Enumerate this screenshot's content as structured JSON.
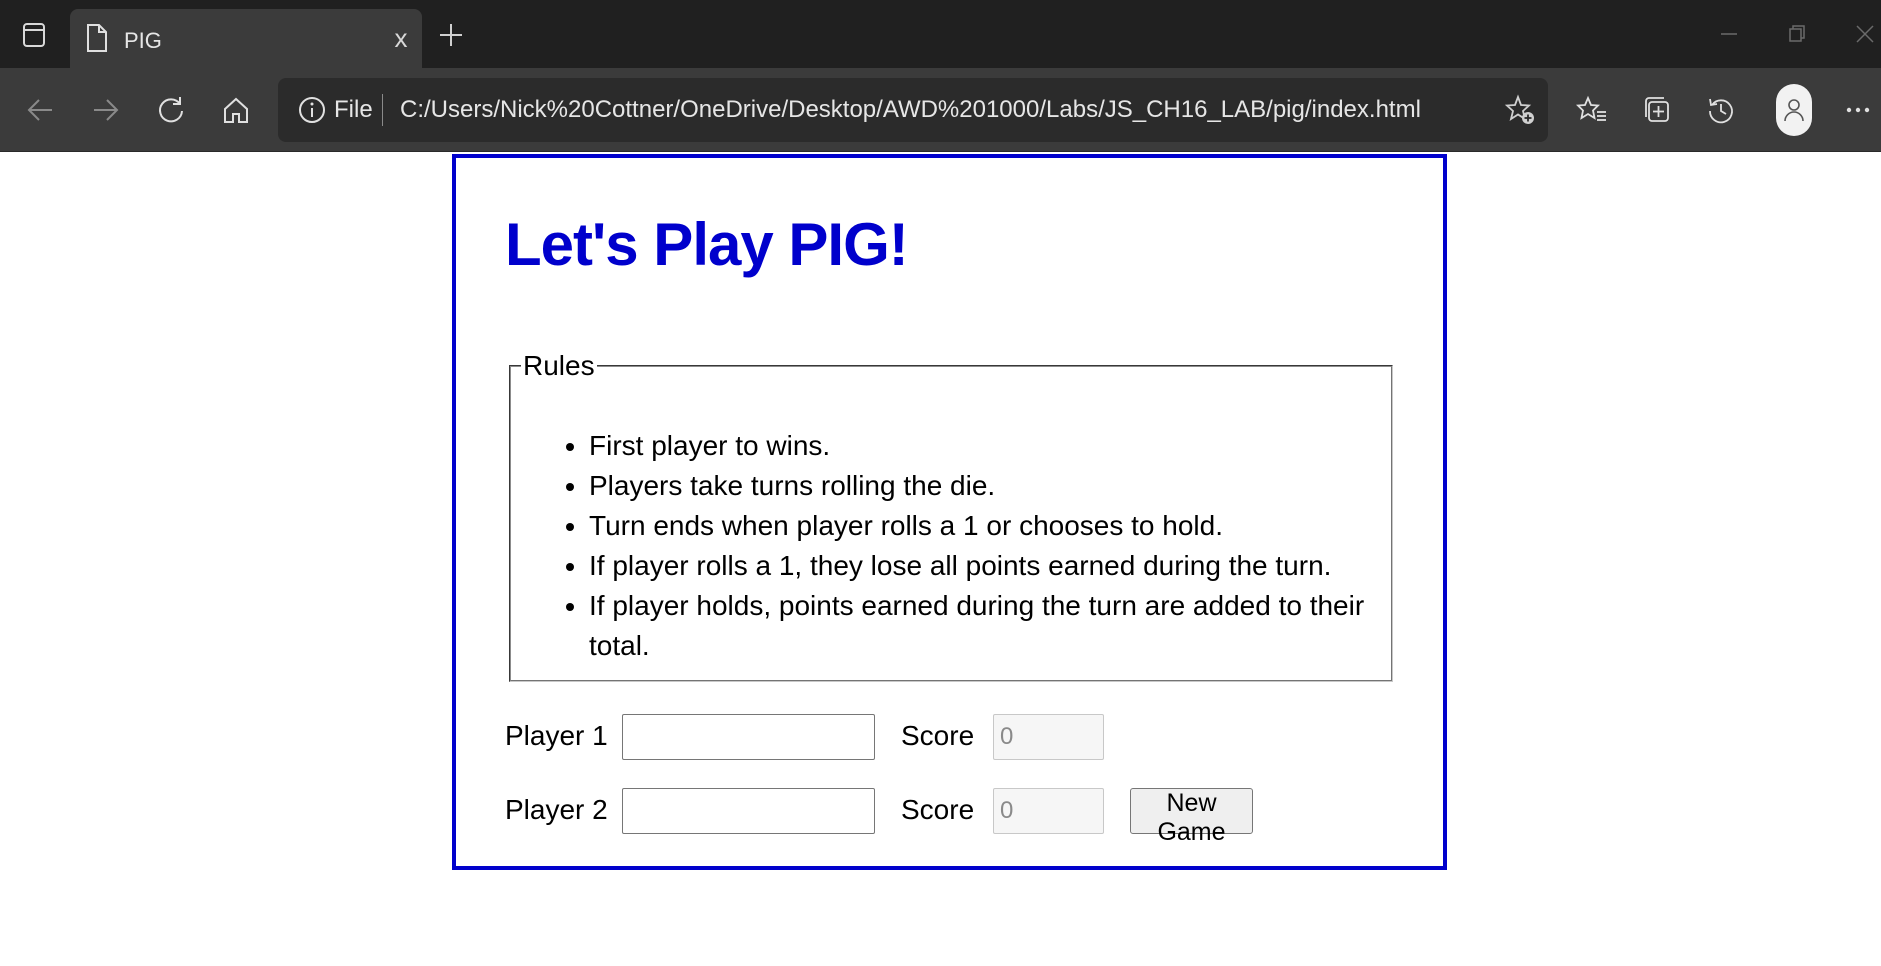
{
  "browser": {
    "tab_title": "PIG",
    "tab_close_label": "x",
    "address_scheme": "File",
    "address_url": "C:/Users/Nick%20Cottner/OneDrive/Desktop/AWD%201000/Labs/JS_CH16_LAB/pig/index.html",
    "icons": {
      "tab_actions": "tab-actions-icon",
      "page": "page-icon",
      "new_tab": "plus-icon",
      "minimize": "minimize-icon",
      "restore": "restore-icon",
      "close": "close-icon",
      "back": "back-arrow-icon",
      "forward": "forward-arrow-icon",
      "refresh": "refresh-icon",
      "home": "home-icon",
      "info": "info-icon",
      "add_favorite": "star-plus-icon",
      "favorites": "favorites-icon",
      "collections": "collections-icon",
      "history": "history-icon",
      "profile": "profile-icon",
      "menu": "more-icon"
    }
  },
  "page": {
    "title": "Let's Play PIG!",
    "rules": {
      "legend": "Rules",
      "items": [
        "First player to wins.",
        "Players take turns rolling the die.",
        "Turn ends when player rolls a 1 or chooses to hold.",
        "If player rolls a 1, they lose all points earned during the turn.",
        "If player holds, points earned during the turn are added to their total."
      ]
    },
    "players": [
      {
        "label": "Player 1",
        "name_value": "",
        "score_label": "Score",
        "score_value": "0"
      },
      {
        "label": "Player 2",
        "name_value": "",
        "score_label": "Score",
        "score_value": "0"
      }
    ],
    "new_game_label": "New Game"
  },
  "colors": {
    "accent": "#0000cc",
    "chrome_dark": "#202020",
    "chrome_mid": "#3b3b3b",
    "address_bg": "#2b2b2b"
  }
}
